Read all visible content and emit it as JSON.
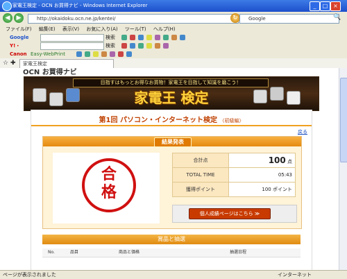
{
  "window": {
    "title": "家電王検定 - OCN お買得ナビ - Windows Internet Explorer",
    "min": "_",
    "max": "□",
    "close": "×"
  },
  "address_bar": {
    "url": "http://okaidoku.ocn.ne.jp/kentei/",
    "search_text": "Google"
  },
  "menu": [
    "ファイル(F)",
    "編集(E)",
    "表示(V)",
    "お気に入り(A)",
    "ツール(T)",
    "ヘルプ(H)"
  ],
  "toolbar1": {
    "label": "Google",
    "search_label": "検索"
  },
  "toolbar2": {
    "label": "Y!・",
    "search_label": "検索"
  },
  "toolbar3": {
    "brand": "Canon",
    "product": "Easy-WebPrint"
  },
  "tab": {
    "label": "家電王検定"
  },
  "logo": {
    "prefix": "OCN",
    "main": "お買得ナビ",
    "highlight": "得"
  },
  "banner": {
    "tagline": "目指すはもっとお得なお買物！家電王を目指して知識を磨こう！",
    "title": "家電王 検定"
  },
  "test": {
    "title": "第1回 パソコン・インターネット検定",
    "level": "〈初級編〉",
    "back_link": "戻る"
  },
  "result": {
    "heading": "結果発表",
    "stamp_line1": "合",
    "stamp_line2": "格",
    "rows": [
      {
        "key": "合計点",
        "value": "100",
        "unit": "点"
      },
      {
        "key": "TOTAL TIME",
        "value": "05:43",
        "unit": ""
      },
      {
        "key": "獲得ポイント",
        "value": "100",
        "unit": "ポイント"
      }
    ],
    "button_label": "個人成績ページはこちら ≫"
  },
  "awards": {
    "heading": "賞品と抽選",
    "columns": [
      "No.",
      "品目",
      "商品と価格",
      "抽選日程"
    ]
  },
  "status": {
    "text": "ページが表示されました",
    "zone": "インターネット"
  },
  "colors": {
    "accent": "#e58a10",
    "stamp": "#d01010",
    "brand_red": "#e02020"
  }
}
